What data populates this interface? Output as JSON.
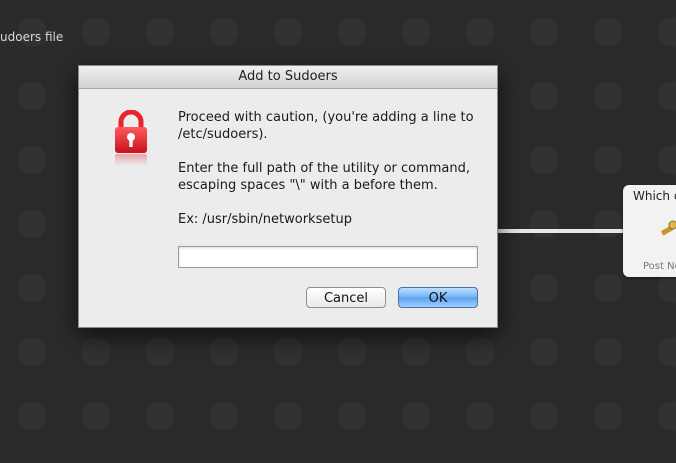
{
  "background": {
    "label": "udoers file",
    "side_card": {
      "title": "Which c",
      "caption": "Post No",
      "icon": "tool-icon"
    }
  },
  "dialog": {
    "title": "Add to Sudoers",
    "icon": "padlock-icon",
    "icon_color": "#e8232b",
    "message_caution": "Proceed with caution, (you're adding a line to /etc/sudoers).",
    "message_instructions": "Enter the full path of the utility or command, escaping spaces \"\\\" with a before them.",
    "message_example": "Ex: /usr/sbin/networksetup",
    "input": {
      "value": "",
      "placeholder": ""
    },
    "cancel_label": "Cancel",
    "ok_label": "OK"
  },
  "colors": {
    "background": "#2b2b2b",
    "dialog": "#ececec",
    "ok_button": "#6fb1f5"
  }
}
